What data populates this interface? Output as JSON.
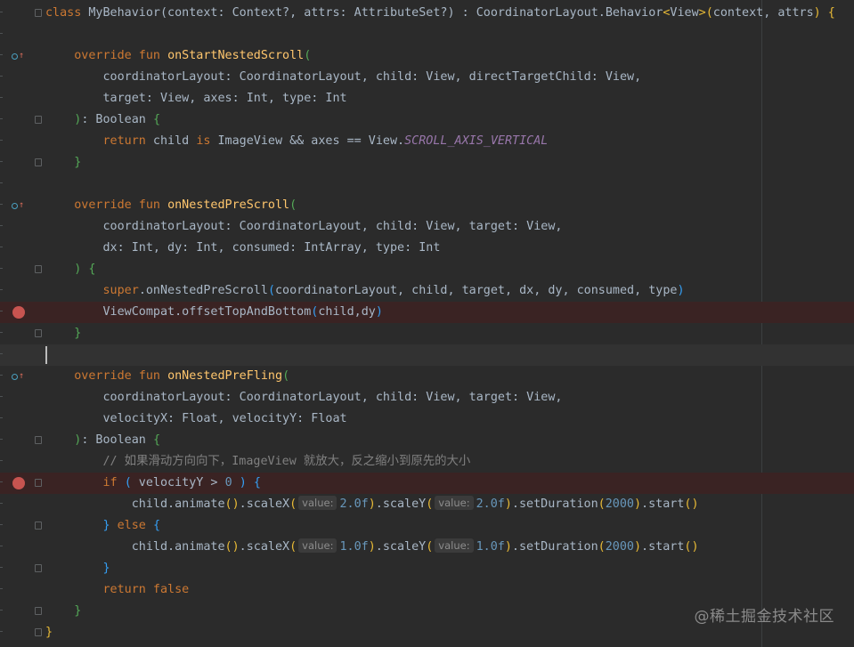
{
  "editor": {
    "language": "Kotlin",
    "lines": [
      {
        "tokens": [
          {
            "t": "class",
            "c": "kw"
          },
          {
            "t": " MyBehavior(context: Context?, attrs: AttributeSet?) : CoordinatorLayout.Behavior"
          },
          {
            "t": "<",
            "c": "p1"
          },
          {
            "t": "View"
          },
          {
            "t": ">",
            "c": "p1"
          },
          {
            "t": "(",
            "c": "p1"
          },
          {
            "t": "context, attrs"
          },
          {
            "t": ")",
            "c": "p1"
          },
          {
            "t": " "
          },
          {
            "t": "{",
            "c": "p1"
          }
        ]
      },
      {
        "tokens": []
      },
      {
        "tokens": [
          {
            "t": "    "
          },
          {
            "t": "override fun",
            "c": "kw"
          },
          {
            "t": " "
          },
          {
            "t": "onStartNestedScroll",
            "c": "fn"
          },
          {
            "t": "(",
            "c": "p2"
          }
        ]
      },
      {
        "tokens": [
          {
            "t": "        coordinatorLayout: CoordinatorLayout, child: View, directTargetChild: View,"
          }
        ]
      },
      {
        "tokens": [
          {
            "t": "        target: View, axes: Int, type: Int"
          }
        ]
      },
      {
        "tokens": [
          {
            "t": "    "
          },
          {
            "t": ")",
            "c": "p2"
          },
          {
            "t": ": Boolean "
          },
          {
            "t": "{",
            "c": "p2"
          }
        ]
      },
      {
        "tokens": [
          {
            "t": "        "
          },
          {
            "t": "return",
            "c": "kw"
          },
          {
            "t": " child "
          },
          {
            "t": "is",
            "c": "kw"
          },
          {
            "t": " ImageView && axes == View."
          },
          {
            "t": "SCROLL_AXIS_VERTICAL",
            "c": "const"
          }
        ]
      },
      {
        "tokens": [
          {
            "t": "    "
          },
          {
            "t": "}",
            "c": "p2"
          }
        ]
      },
      {
        "tokens": []
      },
      {
        "tokens": [
          {
            "t": "    "
          },
          {
            "t": "override fun",
            "c": "kw"
          },
          {
            "t": " "
          },
          {
            "t": "onNestedPreScroll",
            "c": "fn"
          },
          {
            "t": "(",
            "c": "p2"
          }
        ]
      },
      {
        "tokens": [
          {
            "t": "        coordinatorLayout: CoordinatorLayout, child: View, target: View,"
          }
        ]
      },
      {
        "tokens": [
          {
            "t": "        dx: Int, dy: Int, consumed: IntArray, type: Int"
          }
        ]
      },
      {
        "tokens": [
          {
            "t": "    "
          },
          {
            "t": ")",
            "c": "p2"
          },
          {
            "t": " "
          },
          {
            "t": "{",
            "c": "p2"
          }
        ]
      },
      {
        "tokens": [
          {
            "t": "        "
          },
          {
            "t": "super",
            "c": "kw"
          },
          {
            "t": ".onNestedPreScroll"
          },
          {
            "t": "(",
            "c": "p3"
          },
          {
            "t": "coordinatorLayout, child, target, dx, dy, consumed, type"
          },
          {
            "t": ")",
            "c": "p3"
          }
        ]
      },
      {
        "tokens": [
          {
            "t": "        ViewCompat.offsetTopAndBottom"
          },
          {
            "t": "(",
            "c": "p3"
          },
          {
            "t": "child,dy"
          },
          {
            "t": ")",
            "c": "p3"
          }
        ]
      },
      {
        "tokens": [
          {
            "t": "    "
          },
          {
            "t": "}",
            "c": "p2"
          }
        ]
      },
      {
        "tokens": []
      },
      {
        "tokens": [
          {
            "t": "    "
          },
          {
            "t": "override fun",
            "c": "kw"
          },
          {
            "t": " "
          },
          {
            "t": "onNestedPreFling",
            "c": "fn"
          },
          {
            "t": "(",
            "c": "p2"
          }
        ]
      },
      {
        "tokens": [
          {
            "t": "        coordinatorLayout: CoordinatorLayout, child: View, target: View,"
          }
        ]
      },
      {
        "tokens": [
          {
            "t": "        velocityX: Float, velocityY: Float"
          }
        ]
      },
      {
        "tokens": [
          {
            "t": "    "
          },
          {
            "t": ")",
            "c": "p2"
          },
          {
            "t": ": Boolean "
          },
          {
            "t": "{",
            "c": "p2"
          }
        ]
      },
      {
        "tokens": [
          {
            "t": "        "
          },
          {
            "t": "// 如果滑动方向向下，ImageView 就放大，反之缩小到原先的大小",
            "c": "cm"
          }
        ]
      },
      {
        "tokens": [
          {
            "t": "        "
          },
          {
            "t": "if",
            "c": "kw"
          },
          {
            "t": " "
          },
          {
            "t": "(",
            "c": "p3"
          },
          {
            "t": " velocityY > "
          },
          {
            "t": "0",
            "c": "num"
          },
          {
            "t": " "
          },
          {
            "t": ")",
            "c": "p3"
          },
          {
            "t": " "
          },
          {
            "t": "{",
            "c": "p3"
          }
        ]
      },
      {
        "tokens": [
          {
            "t": "            child.animate"
          },
          {
            "t": "()",
            "c": "p1"
          },
          {
            "t": ".scaleX"
          },
          {
            "t": "(",
            "c": "p1"
          },
          {
            "t": "value:",
            "c": "hint"
          },
          {
            "t": "2.0f",
            "c": "num"
          },
          {
            "t": ")",
            "c": "p1"
          },
          {
            "t": ".scaleY"
          },
          {
            "t": "(",
            "c": "p1"
          },
          {
            "t": "value:",
            "c": "hint"
          },
          {
            "t": "2.0f",
            "c": "num"
          },
          {
            "t": ")",
            "c": "p1"
          },
          {
            "t": ".setDuration"
          },
          {
            "t": "(",
            "c": "p1"
          },
          {
            "t": "2000",
            "c": "num"
          },
          {
            "t": ")",
            "c": "p1"
          },
          {
            "t": ".start"
          },
          {
            "t": "()",
            "c": "p1"
          }
        ]
      },
      {
        "tokens": [
          {
            "t": "        "
          },
          {
            "t": "}",
            "c": "p3"
          },
          {
            "t": " "
          },
          {
            "t": "else",
            "c": "kw"
          },
          {
            "t": " "
          },
          {
            "t": "{",
            "c": "p3"
          }
        ]
      },
      {
        "tokens": [
          {
            "t": "            child.animate"
          },
          {
            "t": "()",
            "c": "p1"
          },
          {
            "t": ".scaleX"
          },
          {
            "t": "(",
            "c": "p1"
          },
          {
            "t": "value:",
            "c": "hint"
          },
          {
            "t": "1.0f",
            "c": "num"
          },
          {
            "t": ")",
            "c": "p1"
          },
          {
            "t": ".scaleY"
          },
          {
            "t": "(",
            "c": "p1"
          },
          {
            "t": "value:",
            "c": "hint"
          },
          {
            "t": "1.0f",
            "c": "num"
          },
          {
            "t": ")",
            "c": "p1"
          },
          {
            "t": ".setDuration"
          },
          {
            "t": "(",
            "c": "p1"
          },
          {
            "t": "2000",
            "c": "num"
          },
          {
            "t": ")",
            "c": "p1"
          },
          {
            "t": ".start"
          },
          {
            "t": "()",
            "c": "p1"
          }
        ]
      },
      {
        "tokens": [
          {
            "t": "        "
          },
          {
            "t": "}",
            "c": "p3"
          }
        ]
      },
      {
        "tokens": [
          {
            "t": "        "
          },
          {
            "t": "return false",
            "c": "kw"
          }
        ]
      },
      {
        "tokens": [
          {
            "t": "    "
          },
          {
            "t": "}",
            "c": "p2"
          }
        ]
      },
      {
        "tokens": [
          {
            "t": "}",
            "c": "p1"
          }
        ]
      }
    ],
    "breakpoint_lines": [
      14,
      22
    ],
    "override_marker_lines": [
      2,
      9,
      17
    ],
    "fold_marker_lines": [
      0,
      5,
      7,
      12,
      15,
      20,
      22,
      24,
      26,
      28,
      29
    ],
    "caret_line": 16
  },
  "colors": {
    "background": "#2b2b2b",
    "text": "#a9b7c6",
    "keyword": "#cc7832",
    "function": "#ffc66d",
    "number": "#6897bb",
    "comment": "#808080",
    "constant": "#9876aa",
    "breakpoint": "#c75450",
    "breakpoint_line": "#3a2323"
  },
  "watermark": "@稀土掘金技术社区"
}
